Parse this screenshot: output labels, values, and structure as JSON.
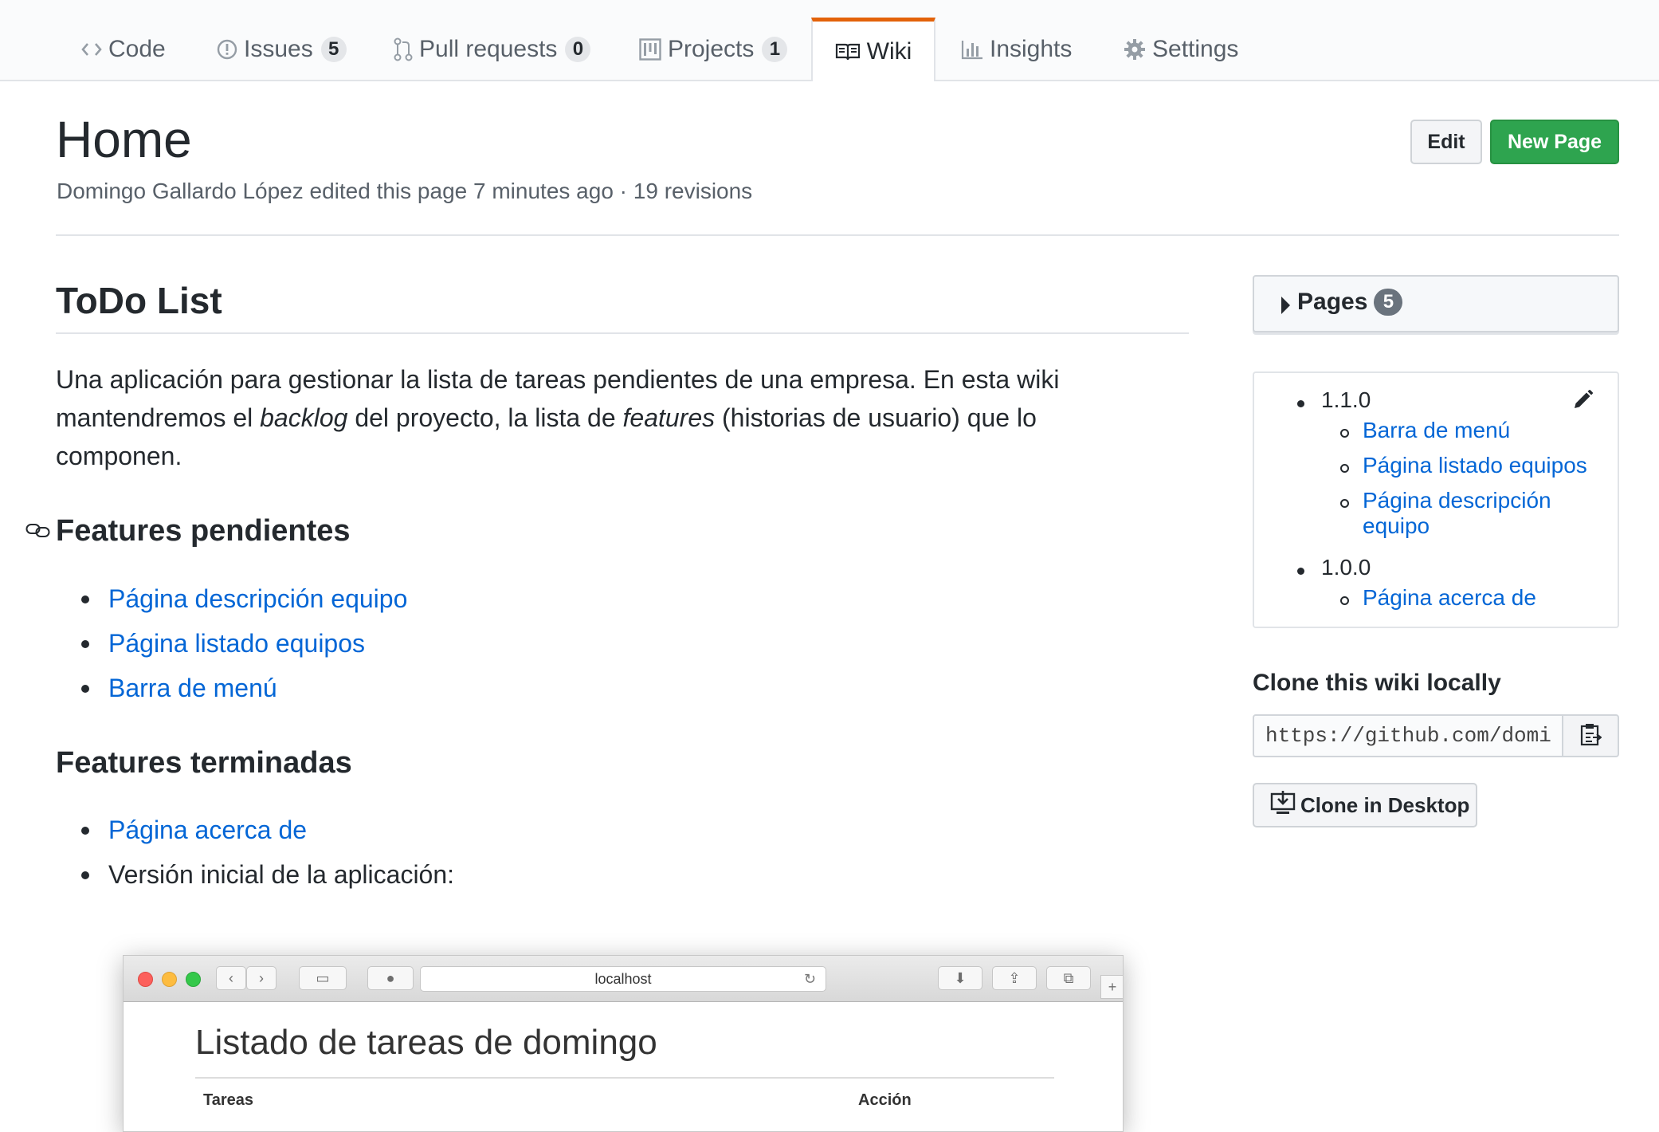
{
  "tabs": [
    {
      "label": "Code",
      "icon": "code-icon"
    },
    {
      "label": "Issues",
      "count": "5",
      "icon": "issue-icon"
    },
    {
      "label": "Pull requests",
      "count": "0",
      "icon": "pull-request-icon"
    },
    {
      "label": "Projects",
      "count": "1",
      "icon": "project-icon"
    },
    {
      "label": "Wiki",
      "icon": "book-icon",
      "selected": true
    },
    {
      "label": "Insights",
      "icon": "graph-icon"
    },
    {
      "label": "Settings",
      "icon": "gear-icon"
    }
  ],
  "colors": {
    "accent_tab": "#e36209",
    "link": "#0366d6",
    "primary_button": "#2ea44f"
  },
  "page": {
    "title": "Home",
    "meta": "Domingo Gallardo López edited this page 7 minutes ago · 19 revisions",
    "edit_label": "Edit",
    "new_page_label": "New Page"
  },
  "content": {
    "heading": "ToDo List",
    "intro_1": "Una aplicación para gestionar la lista de tareas pendientes de una empresa. En esta wiki mantendremos el ",
    "intro_em1": "backlog",
    "intro_2": " del proyecto, la lista de ",
    "intro_em2": "features",
    "intro_3": " (historias de usuario) que lo componen.",
    "pending_heading": "Features pendientes",
    "pending": [
      "Página descripción equipo",
      "Página listado equipos",
      "Barra de menú"
    ],
    "done_heading": "Features terminadas",
    "done_link": "Página acerca de",
    "done_text": "Versión inicial de la aplicación:"
  },
  "screenshot": {
    "url": "localhost",
    "title": "Listado de tareas de domingo",
    "col_tasks": "Tareas",
    "col_action": "Acción"
  },
  "sidebar": {
    "pages_label": "Pages",
    "pages_count": "5",
    "toc": {
      "v1": "1.1.0",
      "v1_items": [
        "Barra de menú",
        "Página listado equipos",
        "Página descripción",
        "equipo"
      ],
      "v0": "1.0.0",
      "v0_items": [
        "Página acerca de"
      ]
    },
    "clone_title": "Clone this wiki locally",
    "clone_url": "https://github.com/domingogallardo/todolist.wiki.git",
    "clone_desktop": "Clone in Desktop"
  }
}
